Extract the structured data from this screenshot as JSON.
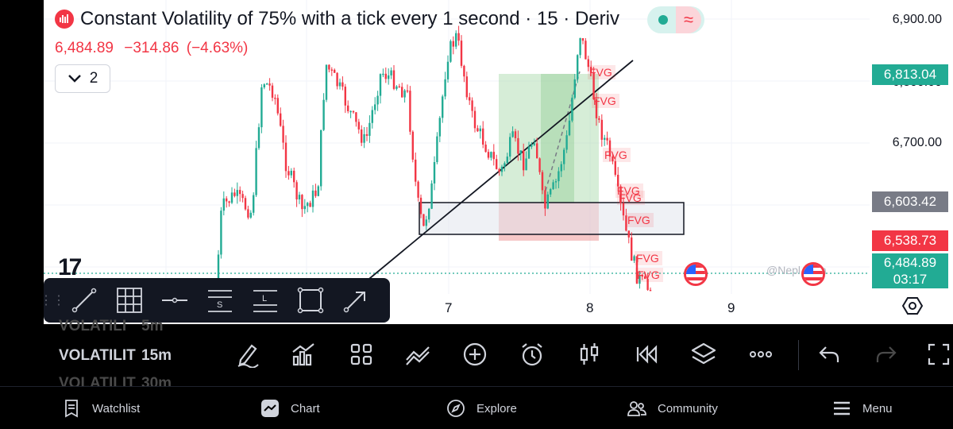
{
  "header": {
    "title": "Constant Volatility of 75% with a tick every 1 second · 15 · Deriv",
    "last_price": "6,484.89",
    "change": "−314.86",
    "change_pct": "(−4.63%)",
    "indicator_count": "2",
    "status_color": "#22ab94"
  },
  "price_axis": {
    "labels": [
      "6,900.00",
      "6,800.00",
      "6,700.00"
    ],
    "tags": {
      "high": "6,813.04",
      "mid": "6,603.42",
      "low": "6,538.73",
      "current": "6,484.89",
      "countdown": "03:17"
    },
    "tag_colors": {
      "high": "#22ab94",
      "mid": "#787b86",
      "low": "#f23645",
      "current": "#22ab94"
    }
  },
  "time_axis": {
    "labels": [
      "7",
      "8",
      "9"
    ]
  },
  "annotations": {
    "fvg_label": "FVG",
    "fvg_count": 8
  },
  "watermark": "@Nepl         Sam",
  "logo_text": "17",
  "drawing_toolbar": {
    "tools": [
      "trend-line",
      "grid",
      "horizontal-line",
      "s-lines",
      "l-lines",
      "rectangle",
      "arrow"
    ],
    "tool_letters": {
      "s": "S",
      "l": "L"
    }
  },
  "interval_picker": {
    "symbol": "VOLATILITY",
    "rows": [
      {
        "symbol": "VOLATILI",
        "interval": "5m",
        "state": "dim"
      },
      {
        "symbol": "VOLATILIT",
        "interval": "15m",
        "state": "active"
      },
      {
        "symbol": "VOLATILIT",
        "interval": "30m",
        "state": "dim"
      }
    ]
  },
  "toolbar_icons": [
    "pencil-icon",
    "indicators-icon",
    "layouts-icon",
    "compare-icon",
    "add-icon",
    "alert-icon",
    "candles-icon",
    "replay-icon",
    "layers-icon",
    "more-icon",
    "undo-icon",
    "redo-icon",
    "fullscreen-icon"
  ],
  "bottom_nav": {
    "watchlist": "Watchlist",
    "chart": "Chart",
    "explore": "Explore",
    "community": "Community",
    "menu": "Menu"
  },
  "colors": {
    "up": "#22ab94",
    "down": "#f23645",
    "trend_line": "#131722",
    "zone_green": "#a5d6a7",
    "zone_red": "#ef9a9a"
  }
}
